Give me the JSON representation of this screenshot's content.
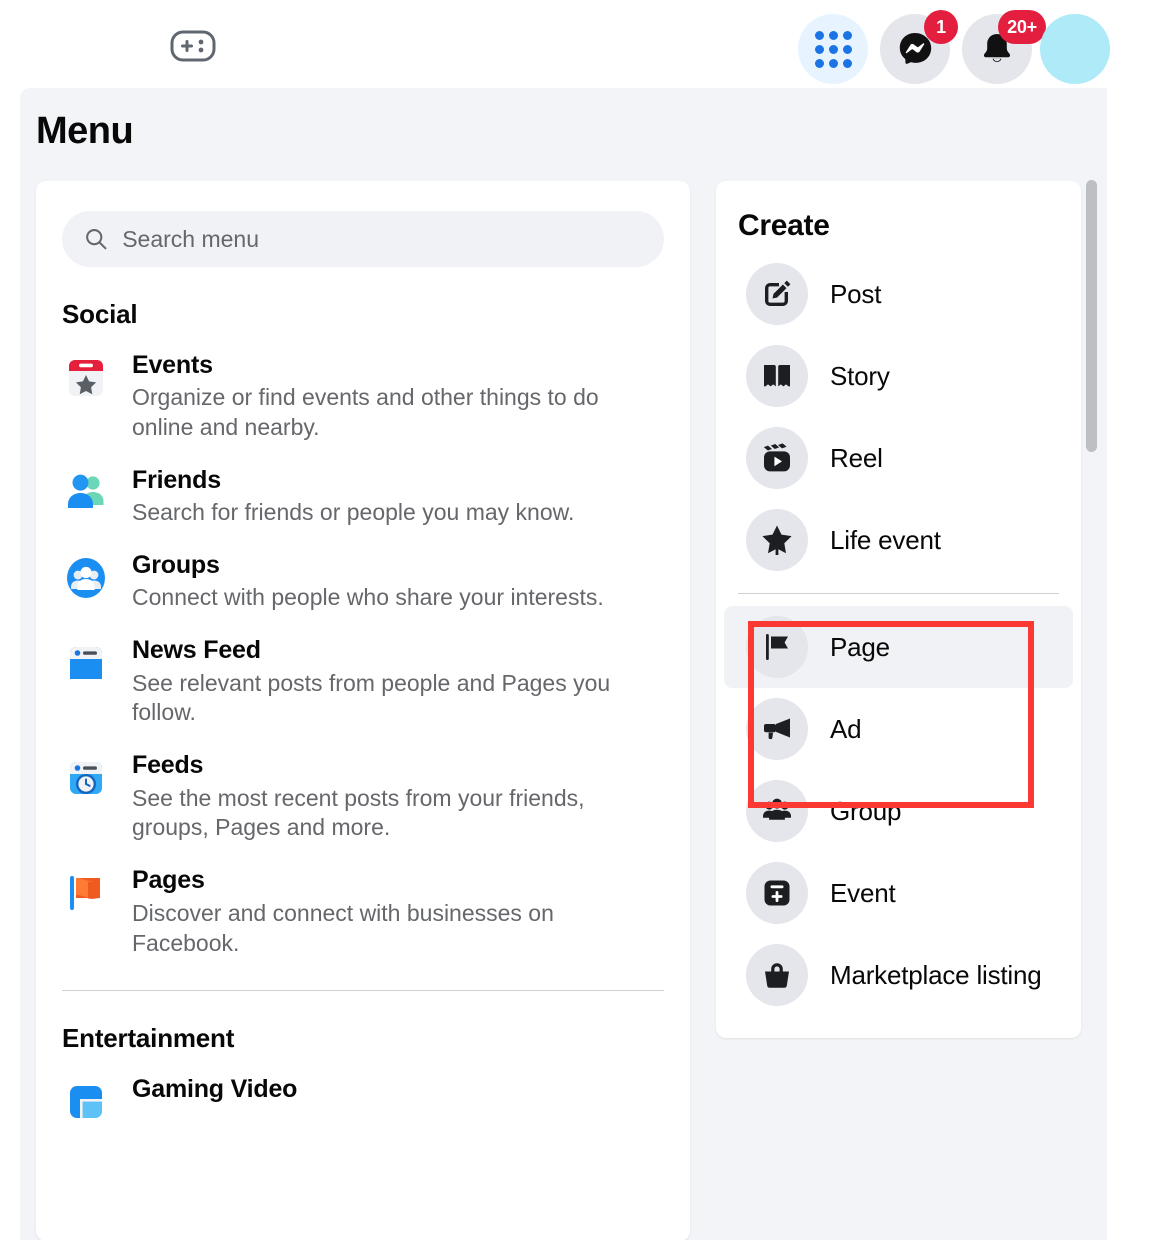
{
  "topbar": {
    "gaming_icon": "game-controller-icon",
    "grid_icon": "apps-grid-icon",
    "messenger_icon": "messenger-icon",
    "messenger_badge": "1",
    "notifications_icon": "bell-icon",
    "notifications_badge": "20+",
    "avatar": "profile-avatar"
  },
  "page": {
    "title": "Menu"
  },
  "search": {
    "value": "",
    "placeholder": "Search menu",
    "icon": "search-icon"
  },
  "sections": [
    {
      "title": "Social",
      "items": [
        {
          "icon": "events-calendar-star-icon",
          "title": "Events",
          "desc": "Organize or find events and other things to do online and nearby."
        },
        {
          "icon": "friends-people-icon",
          "title": "Friends",
          "desc": "Search for friends or people you may know."
        },
        {
          "icon": "groups-people-circle-icon",
          "title": "Groups",
          "desc": "Connect with people who share your interests."
        },
        {
          "icon": "news-feed-icon",
          "title": "News Feed",
          "desc": "See relevant posts from people and Pages you follow."
        },
        {
          "icon": "feeds-clock-icon",
          "title": "Feeds",
          "desc": "See the most recent posts from your friends, groups, Pages and more."
        },
        {
          "icon": "pages-flag-icon",
          "title": "Pages",
          "desc": "Discover and connect with businesses on Facebook."
        }
      ]
    },
    {
      "title": "Entertainment",
      "items": [
        {
          "icon": "gaming-video-icon",
          "title": "Gaming Video",
          "desc": ""
        }
      ]
    }
  ],
  "create": {
    "title": "Create",
    "items": [
      {
        "icon": "post-pencil-square-icon",
        "label": "Post",
        "hovered": false,
        "separator_after": false
      },
      {
        "icon": "story-book-icon",
        "label": "Story",
        "hovered": false,
        "separator_after": false
      },
      {
        "icon": "reel-clapperboard-icon",
        "label": "Reel",
        "hovered": false,
        "separator_after": false
      },
      {
        "icon": "life-event-star-icon",
        "label": "Life event",
        "hovered": false,
        "separator_after": true
      },
      {
        "icon": "page-flag-icon",
        "label": "Page",
        "hovered": true,
        "separator_after": false
      },
      {
        "icon": "ad-megaphone-icon",
        "label": "Ad",
        "hovered": false,
        "separator_after": false
      },
      {
        "icon": "group-people-icon",
        "label": "Group",
        "hovered": false,
        "separator_after": false
      },
      {
        "icon": "event-plus-icon",
        "label": "Event",
        "hovered": false,
        "separator_after": false
      },
      {
        "icon": "marketplace-basket-icon",
        "label": "Marketplace listing",
        "hovered": false,
        "separator_after": false
      }
    ]
  },
  "highlight": {
    "target": "Page",
    "color": "#fc3832"
  },
  "colors": {
    "accent": "#1b74e4",
    "badge": "#e41e3f",
    "highlight": "#fc3832",
    "page_bg": "#f2f4f7",
    "card_bg": "#ffffff",
    "text_primary": "#080809",
    "text_secondary": "#65676b"
  }
}
